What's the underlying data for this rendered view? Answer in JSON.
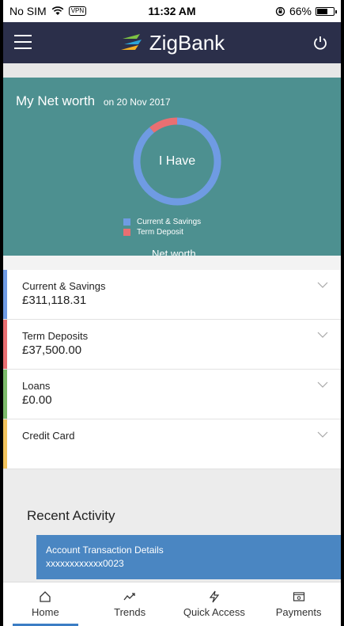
{
  "status_bar": {
    "carrier": "No SIM",
    "vpn": "VPN",
    "time": "11:32 AM",
    "battery_pct": "66%",
    "battery_level": 0.66
  },
  "header": {
    "app_name": "ZigBank",
    "menu_icon": "hamburger-icon",
    "power_icon": "power-icon"
  },
  "net_worth": {
    "title": "My Net worth",
    "date": "on 20 Nov 2017",
    "center_label": "I Have",
    "segments": [
      {
        "name": "Current & Savings",
        "color": "#6f9be3",
        "fraction": 0.892
      },
      {
        "name": "Term Deposit",
        "color": "#ea6f72",
        "fraction": 0.108
      }
    ],
    "cut_off_label": "Net worth"
  },
  "accounts": [
    {
      "name": "Current & Savings",
      "amount": "£311,118.31",
      "color": "#6f9be3"
    },
    {
      "name": "Term Deposits",
      "amount": "£37,500.00",
      "color": "#ea6f72"
    },
    {
      "name": "Loans",
      "amount": "£0.00",
      "color": "#7dbb6b"
    },
    {
      "name": "Credit Card",
      "amount": "",
      "color": "#f2c35d"
    }
  ],
  "recent_activity": {
    "title": "Recent Activity",
    "card_title": "Account Transaction Details",
    "card_sub": "xxxxxxxxxxxx0023"
  },
  "tabs": [
    {
      "label": "Home",
      "icon": "home-icon",
      "active": true
    },
    {
      "label": "Trends",
      "icon": "trends-icon",
      "active": false
    },
    {
      "label": "Quick Access",
      "icon": "lightning-icon",
      "active": false
    },
    {
      "label": "Payments",
      "icon": "payments-icon",
      "active": false
    }
  ],
  "colors": {
    "header": "#2b2f4a",
    "networth_bg": "#4d9090",
    "accent": "#3b7dc4"
  }
}
